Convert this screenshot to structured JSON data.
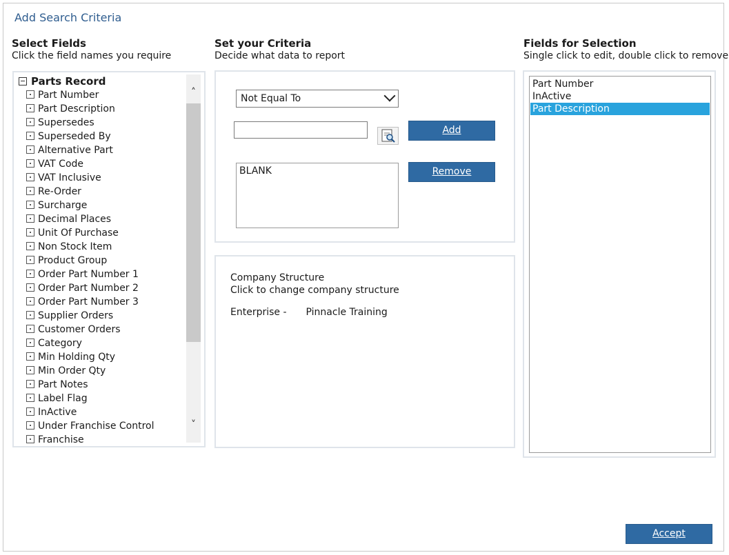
{
  "window_title": "Add Search Criteria",
  "columns": {
    "select_fields": {
      "heading": "Select Fields",
      "sub": "Click the field names you require"
    },
    "set_criteria": {
      "heading": "Set your Criteria",
      "sub": "Decide what data to report"
    },
    "fields_selection": {
      "heading": "Fields for Selection",
      "sub": "Single click to edit, double click to remove"
    }
  },
  "tree": {
    "root": "Parts Record",
    "items": [
      "Part Number",
      "Part Description",
      "Supersedes",
      "Superseded By",
      "Alternative Part",
      "VAT Code",
      "VAT Inclusive",
      "Re-Order",
      "Surcharge",
      "Decimal Places",
      "Unit Of Purchase",
      "Non Stock Item",
      "Product Group",
      "Order Part Number 1",
      "Order Part Number 2",
      "Order Part Number 3",
      "Supplier Orders",
      "Customer Orders",
      "Category",
      "Min Holding Qty",
      "Min Order Qty",
      "Part Notes",
      "Label Flag",
      "InActive",
      "Under Franchise Control",
      "Franchise"
    ]
  },
  "criteria": {
    "operator": "Not Equal To",
    "value": "",
    "add_label": "Add",
    "remove_label": "Remove",
    "values": [
      "BLANK"
    ]
  },
  "company": {
    "title": "Company Structure",
    "hint": "Click to change company structure",
    "label": "Enterprise -",
    "value": "Pinnacle Training"
  },
  "selected_fields": [
    "Part Number",
    "InActive",
    "Part Description"
  ],
  "accept_label": "Accept"
}
